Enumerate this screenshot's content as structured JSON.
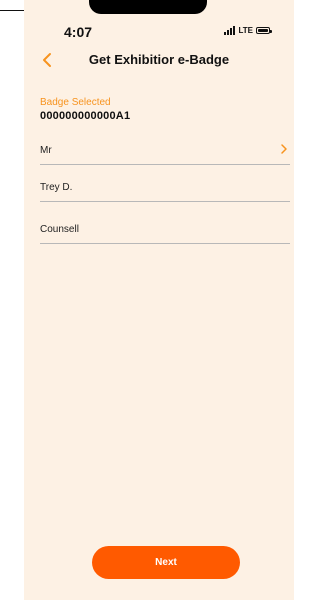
{
  "status_bar": {
    "time": "4:07",
    "network": "LTE"
  },
  "nav": {
    "title": "Get Exhibitior e-Badge",
    "back_icon": "chevron-left-icon"
  },
  "badge": {
    "label": "Badge Selected",
    "value": "000000000000A1"
  },
  "fields": [
    {
      "value": "Mr",
      "has_chevron": true
    },
    {
      "value": "Trey D."
    },
    {
      "value": "Counsell"
    }
  ],
  "next_button": {
    "label": "Next"
  },
  "colors": {
    "accent": "#f7931e",
    "button": "#ff5a00",
    "background": "#fdf1e4"
  }
}
